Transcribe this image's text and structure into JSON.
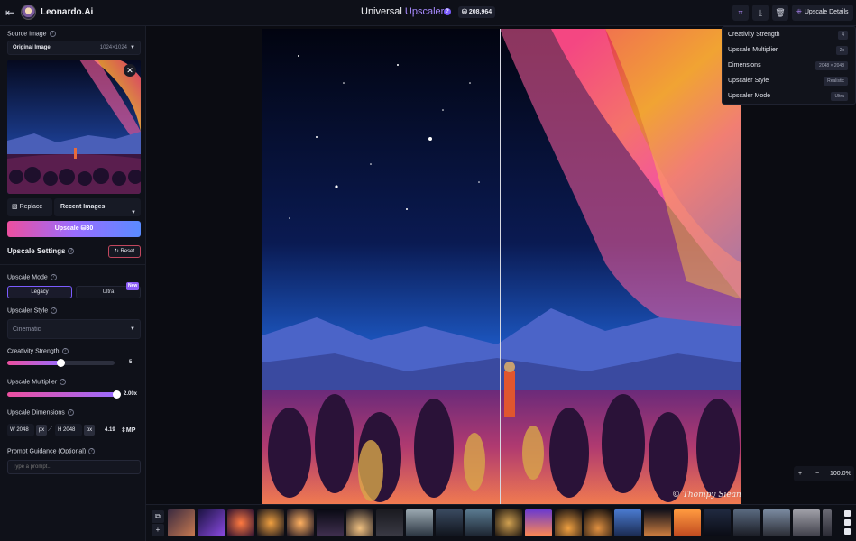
{
  "topbar": {
    "brand": "Leonardo.Ai",
    "title_main": "Universal ",
    "title_accent": "Upscaler",
    "tokens": "208,964",
    "details_label": "Upscale Details"
  },
  "left": {
    "source_image_label": "Source Image",
    "source_select_value": "Original Image",
    "source_resolution": "1024×1024",
    "replace_label": "Replace",
    "recent_label": "Recent Images",
    "upscale_label": "Upscale",
    "upscale_cost": "30",
    "settings_title": "Upscale Settings",
    "reset_label": "Reset",
    "mode_label": "Upscale Mode",
    "mode_legacy": "Legacy",
    "mode_ultra": "Ultra",
    "new_badge": "New",
    "style_label": "Upscaler Style",
    "style_value": "Cinematic",
    "creativity_label": "Creativity Strength",
    "creativity_value": "5",
    "creativity_fraction": 0.5,
    "multiplier_label": "Upscale Multiplier",
    "multiplier_value": "2.00x",
    "multiplier_fraction": 1.0,
    "dimensions_label": "Upscale Dimensions",
    "dim_w_prefix": "W",
    "dim_w": "2048",
    "dim_h_prefix": "H",
    "dim_h": "2048",
    "dim_unit": "px",
    "dim_mp_value": "4.19",
    "dim_mp_unit": "MP",
    "prompt_label": "Prompt Guidance (Optional)",
    "prompt_placeholder": "Type a prompt..."
  },
  "details": {
    "rows": [
      {
        "label": "Creativity Strength",
        "value": "4"
      },
      {
        "label": "Upscale Multiplier",
        "value": "2x"
      },
      {
        "label": "Dimensions",
        "value": "2048 × 2048"
      },
      {
        "label": "Upscaler Style",
        "value": "Realistic"
      },
      {
        "label": "Upscaler Mode",
        "value": "Ultra"
      }
    ]
  },
  "canvas": {
    "signature": "© Thompy Siean",
    "zoom": "100.0%"
  },
  "colors": {
    "accent": "#7b5cff",
    "upscale_gradient_start": "#ec4f9f",
    "upscale_gradient_end": "#5a8bff",
    "reset_border": "#c2475e"
  }
}
